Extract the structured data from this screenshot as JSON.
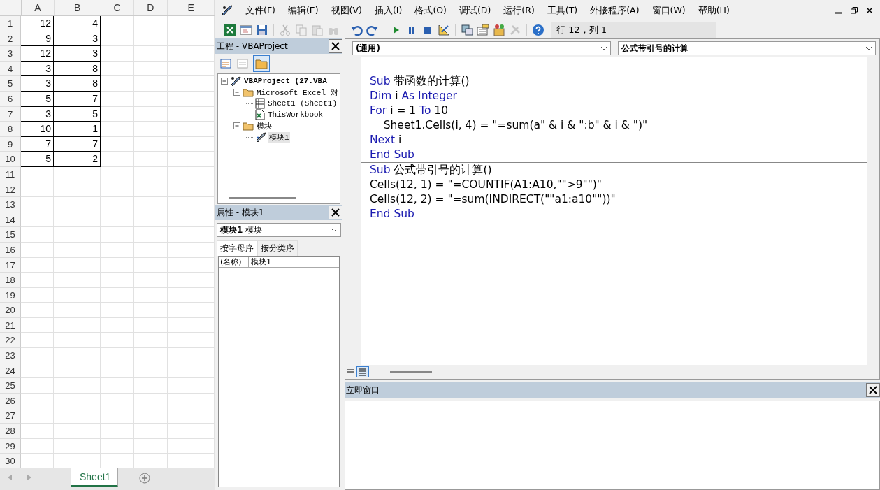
{
  "sheet": {
    "columns": [
      "A",
      "B",
      "C",
      "D",
      "E"
    ],
    "rows": [
      {
        "label": "1",
        "cells": [
          "12",
          "4"
        ]
      },
      {
        "label": "2",
        "cells": [
          "9",
          "3"
        ]
      },
      {
        "label": "3",
        "cells": [
          "12",
          "3"
        ]
      },
      {
        "label": "4",
        "cells": [
          "3",
          "8"
        ]
      },
      {
        "label": "5",
        "cells": [
          "3",
          "8"
        ]
      },
      {
        "label": "6",
        "cells": [
          "5",
          "7"
        ]
      },
      {
        "label": "7",
        "cells": [
          "3",
          "5"
        ]
      },
      {
        "label": "8",
        "cells": [
          "10",
          "1"
        ]
      },
      {
        "label": "9",
        "cells": [
          "7",
          "7"
        ]
      },
      {
        "label": "10",
        "cells": [
          "5",
          "2"
        ]
      },
      {
        "label": "11"
      },
      {
        "label": "12"
      },
      {
        "label": "13"
      },
      {
        "label": "14"
      },
      {
        "label": "15"
      },
      {
        "label": "16"
      },
      {
        "label": "17"
      },
      {
        "label": "18"
      },
      {
        "label": "19"
      },
      {
        "label": "20"
      },
      {
        "label": "21"
      },
      {
        "label": "22"
      },
      {
        "label": "23"
      },
      {
        "label": "24"
      },
      {
        "label": "25"
      },
      {
        "label": "26"
      },
      {
        "label": "27"
      },
      {
        "label": "28"
      },
      {
        "label": "29"
      },
      {
        "label": "30"
      }
    ],
    "tabs": [
      {
        "label": "Sheet1",
        "selected": true
      }
    ]
  },
  "menu": [
    "文件(F)",
    "编辑(E)",
    "视图(V)",
    "插入(I)",
    "格式(O)",
    "调试(D)",
    "运行(R)",
    "工具(T)",
    "外接程序(A)",
    "窗口(W)",
    "帮助(H)"
  ],
  "toolbar": [
    {
      "kind": "excel",
      "disabled": false
    },
    {
      "kind": "form",
      "disabled": false
    },
    {
      "kind": "save",
      "disabled": false
    },
    {
      "kind": "sep"
    },
    {
      "kind": "cut",
      "disabled": true
    },
    {
      "kind": "copy",
      "disabled": true
    },
    {
      "kind": "paste",
      "disabled": true
    },
    {
      "kind": "find",
      "disabled": true
    },
    {
      "kind": "sep"
    },
    {
      "kind": "undo",
      "disabled": false
    },
    {
      "kind": "redo",
      "disabled": false
    },
    {
      "kind": "sep"
    },
    {
      "kind": "run",
      "disabled": false
    },
    {
      "kind": "pause",
      "disabled": false
    },
    {
      "kind": "stop",
      "disabled": false
    },
    {
      "kind": "design",
      "disabled": false
    },
    {
      "kind": "sep"
    },
    {
      "kind": "explorer",
      "disabled": false
    },
    {
      "kind": "properties",
      "disabled": false
    },
    {
      "kind": "browser",
      "disabled": false
    },
    {
      "kind": "toolbox",
      "disabled": true
    },
    {
      "kind": "sep"
    },
    {
      "kind": "help",
      "disabled": false
    }
  ],
  "cursor_position": "行 12，列 1",
  "project": {
    "title": "工程 - VBAProject",
    "tree": [
      {
        "label": "VBAProject (27.VBA",
        "kind": "project",
        "expanded": true,
        "selected": false,
        "children": [
          {
            "label": "Microsoft Excel 对",
            "kind": "folder",
            "expanded": true,
            "selected": false,
            "children": [
              {
                "label": "Sheet1 (Sheet1)",
                "kind": "sheet",
                "selected": false
              },
              {
                "label": "ThisWorkbook",
                "kind": "workbook",
                "selected": false
              }
            ]
          },
          {
            "label": "模块",
            "kind": "folder",
            "expanded": true,
            "selected": false,
            "children": [
              {
                "label": "模块1",
                "kind": "module",
                "selected": true
              }
            ]
          }
        ]
      }
    ]
  },
  "properties": {
    "title": "属性 - 模块1",
    "object": "**模块1** 模块",
    "tabs": [
      {
        "label": "按字母序",
        "selected": true
      },
      {
        "label": "按分类序",
        "selected": false
      }
    ],
    "rows": [
      {
        "name": "(名称)",
        "value": "模块1"
      }
    ]
  },
  "code": {
    "object": "(通用)",
    "procedure": "公式带引号的计算",
    "procedures": [
      {
        "lines": [
          [
            {
              "kind": "keyword",
              "text": "Sub"
            },
            {
              "kind": "plain",
              "text": " 带函数的计算()"
            }
          ],
          [
            {
              "kind": "keyword",
              "text": "Dim"
            },
            {
              "kind": "plain",
              "text": " i "
            },
            {
              "kind": "keyword",
              "text": "As Integer"
            }
          ],
          [
            {
              "kind": "keyword",
              "text": "For"
            },
            {
              "kind": "plain",
              "text": " i = 1 "
            },
            {
              "kind": "keyword",
              "text": "To"
            },
            {
              "kind": "plain",
              "text": " 10"
            }
          ],
          [
            {
              "kind": "plain",
              "text": "    Sheet1.Cells(i, 4) = \"=sum(a\" & i & \":b\" & i & \")\""
            }
          ],
          [
            {
              "kind": "keyword",
              "text": "Next"
            },
            {
              "kind": "plain",
              "text": " i"
            }
          ],
          [
            {
              "kind": "keyword",
              "text": "End Sub"
            }
          ]
        ]
      },
      {
        "lines": [
          [
            {
              "kind": "keyword",
              "text": "Sub"
            },
            {
              "kind": "plain",
              "text": " 公式带引号的计算()"
            }
          ],
          [
            {
              "kind": "plain",
              "text": "Cells(12, 1) = \"=COUNTIF(A1:A10,\"\">9\"\")\""
            }
          ],
          [
            {
              "kind": "plain",
              "text": "Cells(12, 2) = \"=sum(INDIRECT(\"\"a1:a10\"\"))\""
            }
          ],
          [
            {
              "kind": "keyword",
              "text": "End Sub"
            }
          ]
        ]
      }
    ]
  },
  "immediate": {
    "title": "立即窗口"
  }
}
